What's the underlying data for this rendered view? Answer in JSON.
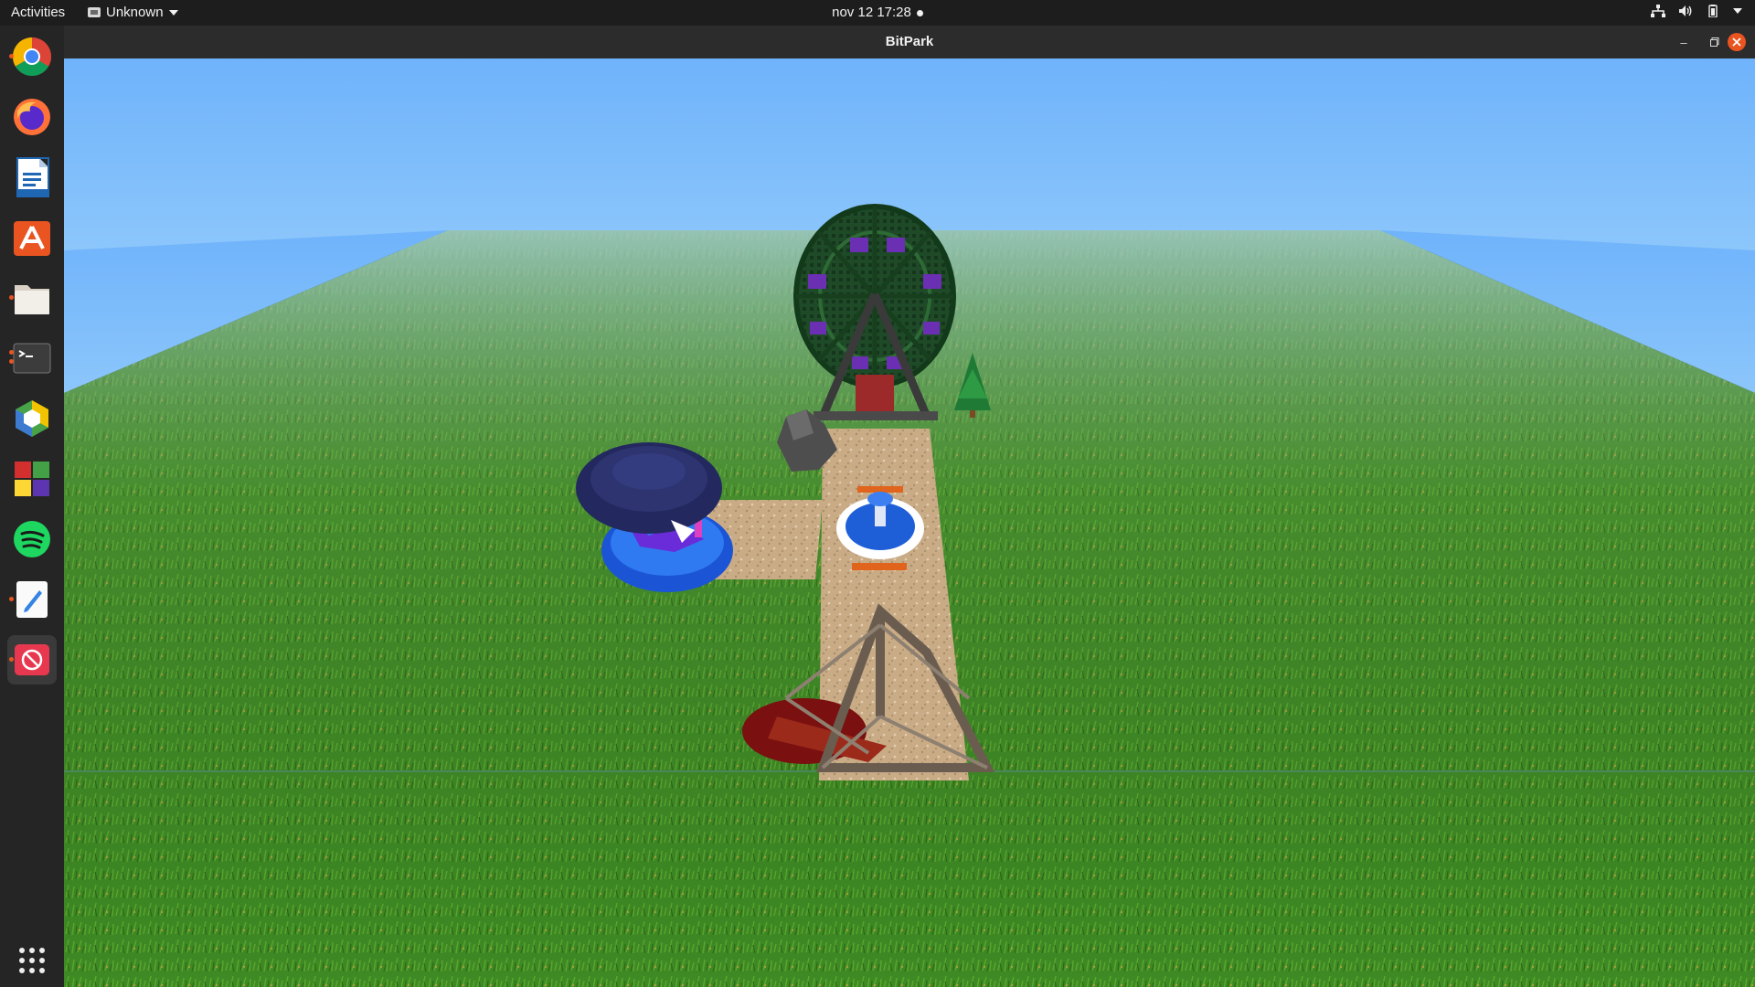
{
  "topbar": {
    "activities": "Activities",
    "app_menu": "Unknown",
    "clock": "nov 12  17:28"
  },
  "dock": {
    "items": [
      {
        "name": "chrome-icon",
        "running": true
      },
      {
        "name": "firefox-icon",
        "running": false
      },
      {
        "name": "writer-icon",
        "running": false
      },
      {
        "name": "app-center-icon",
        "running": false
      },
      {
        "name": "files-icon",
        "running": true
      },
      {
        "name": "terminal-icon",
        "running": true
      },
      {
        "name": "3d-app-icon",
        "running": false
      },
      {
        "name": "colored-grid-app-icon",
        "running": false
      },
      {
        "name": "spotify-icon",
        "running": false
      },
      {
        "name": "text-editor-icon",
        "running": true
      },
      {
        "name": "blocked-app-icon",
        "running": true,
        "active": true
      }
    ],
    "show_apps": "show-applications-icon"
  },
  "window": {
    "title": "BitPark"
  },
  "colors": {
    "sky": "#7dbcfa",
    "grass": "#3f8a22",
    "path": "#c9ac89",
    "accent": "#e95420"
  }
}
